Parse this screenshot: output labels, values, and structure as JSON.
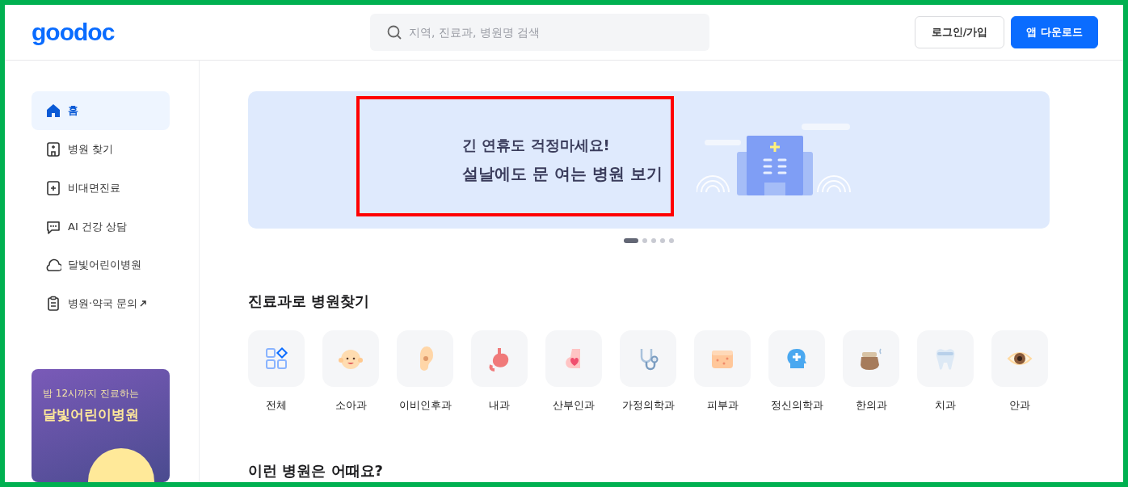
{
  "header": {
    "logo": "goodoc",
    "search": {
      "placeholder": "지역, 진료과, 병원명 검색"
    },
    "buttons": [
      {
        "label": "로그인/가입",
        "kind": "outline"
      },
      {
        "label": "앱 다운로드",
        "kind": "primary"
      }
    ]
  },
  "sidebar": {
    "items": [
      {
        "label": "홈",
        "selected": true,
        "external": false
      },
      {
        "label": "병원 찾기",
        "selected": false,
        "external": false
      },
      {
        "label": "비대면진료",
        "selected": false,
        "external": false
      },
      {
        "label": "AI 건강 상담",
        "selected": false,
        "external": false
      },
      {
        "label": "달빛어린이병원",
        "selected": false,
        "external": false
      },
      {
        "label": "병원·약국 문의",
        "selected": false,
        "external": true
      }
    ],
    "promo": {
      "subtitle": "밤 12시까지 진료하는",
      "title": "달빛어린이병원"
    }
  },
  "banner": {
    "line_1": "긴 연휴도 걱정마세요!",
    "line_2": "설날에도 문 여는 병원 보기",
    "pager": [
      {
        "selected": true
      },
      {
        "selected": false
      },
      {
        "selected": false
      },
      {
        "selected": false
      },
      {
        "selected": false
      }
    ]
  },
  "departments": {
    "title": "진료과로 병원찾기",
    "items": [
      {
        "label": "전체"
      },
      {
        "label": "소아과"
      },
      {
        "label": "이비인후과"
      },
      {
        "label": "내과"
      },
      {
        "label": "산부인과"
      },
      {
        "label": "가정의학과"
      },
      {
        "label": "피부과"
      },
      {
        "label": "정신의학과"
      },
      {
        "label": "한의과"
      },
      {
        "label": "치과"
      },
      {
        "label": "안과"
      }
    ]
  },
  "next_section": {
    "title": "이런 병원은 어때요?"
  }
}
